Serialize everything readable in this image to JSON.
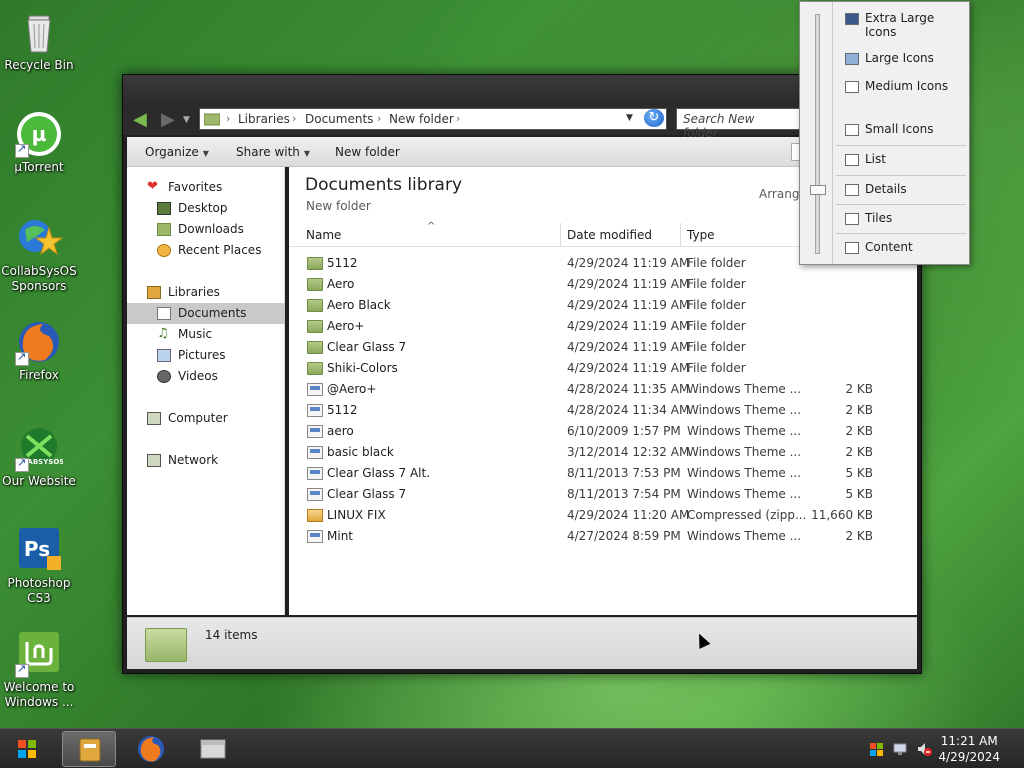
{
  "desktop": {
    "icons": [
      {
        "label": "Recycle Bin"
      },
      {
        "label": "µTorrent"
      },
      {
        "label": "CollabSysOS Sponsors"
      },
      {
        "label": "Firefox"
      },
      {
        "label": "Our Website"
      },
      {
        "label": "Photoshop CS3"
      },
      {
        "label": "Welcome to Windows ..."
      }
    ],
    "website_logo_text": "GABSYSOS"
  },
  "explorer": {
    "breadcrumb": [
      "Libraries",
      "Documents",
      "New folder"
    ],
    "search_placeholder": "Search New folder",
    "toolbar": {
      "organize": "Organize",
      "share_with": "Share with",
      "new_folder": "New folder"
    },
    "nav": {
      "favorites": "Favorites",
      "desktop": "Desktop",
      "downloads": "Downloads",
      "recent_places": "Recent Places",
      "libraries": "Libraries",
      "documents": "Documents",
      "music": "Music",
      "pictures": "Pictures",
      "videos": "Videos",
      "computer": "Computer",
      "network": "Network"
    },
    "library_title": "Documents library",
    "library_subtitle": "New folder",
    "arrange_label": "Arrange",
    "columns": {
      "name": "Name",
      "date": "Date modified",
      "type": "Type"
    },
    "files": [
      {
        "name": "5112",
        "date": "4/29/2024 11:19 AM",
        "type": "File folder",
        "size": "",
        "icon": "folder"
      },
      {
        "name": "Aero",
        "date": "4/29/2024 11:19 AM",
        "type": "File folder",
        "size": "",
        "icon": "folder"
      },
      {
        "name": "Aero Black",
        "date": "4/29/2024 11:19 AM",
        "type": "File folder",
        "size": "",
        "icon": "folder"
      },
      {
        "name": "Aero+",
        "date": "4/29/2024 11:19 AM",
        "type": "File folder",
        "size": "",
        "icon": "folder"
      },
      {
        "name": "Clear Glass 7",
        "date": "4/29/2024 11:19 AM",
        "type": "File folder",
        "size": "",
        "icon": "folder"
      },
      {
        "name": "Shiki-Colors",
        "date": "4/29/2024 11:19 AM",
        "type": "File folder",
        "size": "",
        "icon": "folder"
      },
      {
        "name": "@Aero+",
        "date": "4/28/2024 11:35 AM",
        "type": "Windows Theme ...",
        "size": "2 KB",
        "icon": "theme"
      },
      {
        "name": "5112",
        "date": "4/28/2024 11:34 AM",
        "type": "Windows Theme ...",
        "size": "2 KB",
        "icon": "theme"
      },
      {
        "name": "aero",
        "date": "6/10/2009 1:57 PM",
        "type": "Windows Theme ...",
        "size": "2 KB",
        "icon": "theme"
      },
      {
        "name": "basic black",
        "date": "3/12/2014 12:32 AM",
        "type": "Windows Theme ...",
        "size": "2 KB",
        "icon": "theme"
      },
      {
        "name": "Clear Glass 7 Alt.",
        "date": "8/11/2013 7:53 PM",
        "type": "Windows Theme ...",
        "size": "5 KB",
        "icon": "theme"
      },
      {
        "name": "Clear Glass 7",
        "date": "8/11/2013 7:54 PM",
        "type": "Windows Theme ...",
        "size": "5 KB",
        "icon": "theme"
      },
      {
        "name": "LINUX FIX",
        "date": "4/29/2024 11:20 AM",
        "type": "Compressed (zipp...",
        "size": "11,660 KB",
        "icon": "zip"
      },
      {
        "name": "Mint",
        "date": "4/27/2024 8:59 PM",
        "type": "Windows Theme ...",
        "size": "2 KB",
        "icon": "theme"
      }
    ],
    "status_count": "14 items"
  },
  "view_menu": {
    "items": [
      {
        "label": "Extra Large Icons"
      },
      {
        "label": "Large Icons"
      },
      {
        "label": "Medium Icons"
      },
      {
        "label": "Small Icons"
      },
      {
        "label": "List"
      },
      {
        "label": "Details"
      },
      {
        "label": "Tiles"
      },
      {
        "label": "Content"
      }
    ],
    "selected": "Details"
  },
  "taskbar": {
    "time": "11:21 AM",
    "date": "4/29/2024"
  }
}
